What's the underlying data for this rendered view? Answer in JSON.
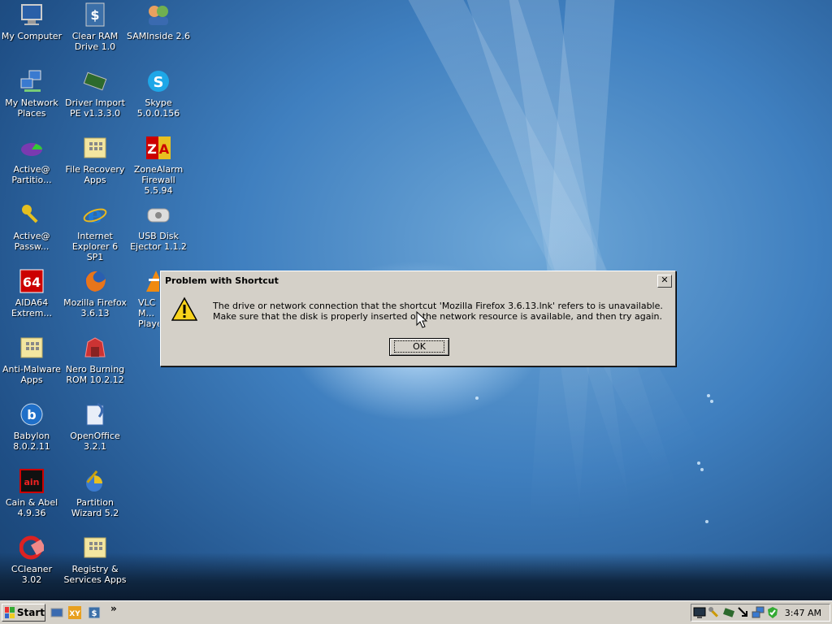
{
  "desktop": {
    "icons": [
      {
        "label": "My Computer",
        "icon": "my-computer-icon"
      },
      {
        "label": "Clear RAM Drive 1.0",
        "icon": "clear-ram-icon"
      },
      {
        "label": "SAMInside 2.6",
        "icon": "saminside-icon"
      },
      {
        "label": "My Network Places",
        "icon": "network-places-icon"
      },
      {
        "label": "Driver Import PE v1.3.3.0",
        "icon": "driver-import-icon"
      },
      {
        "label": "Skype 5.0.0.156",
        "icon": "skype-icon"
      },
      {
        "label": "Active@ Partitio...",
        "icon": "active-partition-icon"
      },
      {
        "label": "File Recovery Apps",
        "icon": "folder-icon"
      },
      {
        "label": "ZoneAlarm Firewall 5.5.94",
        "icon": "zonealarm-icon"
      },
      {
        "label": "Active@ Passw...",
        "icon": "key-icon"
      },
      {
        "label": "Internet Explorer 6 SP1",
        "icon": "internet-explorer-icon"
      },
      {
        "label": "USB Disk Ejector 1.1.2",
        "icon": "usb-disk-icon"
      },
      {
        "label": "AIDA64 Extrem...",
        "icon": "aida64-icon"
      },
      {
        "label": "Mozilla Firefox 3.6.13",
        "icon": "firefox-icon"
      },
      {
        "label": "VLC M... Player",
        "icon": "vlc-icon"
      },
      {
        "label": "Anti-Malware Apps",
        "icon": "folder-icon"
      },
      {
        "label": "Nero Burning ROM 10.2.12",
        "icon": "nero-icon"
      },
      {
        "label": "Babylon 8.0.2.11",
        "icon": "babylon-icon"
      },
      {
        "label": "OpenOffice 3.2.1",
        "icon": "openoffice-icon"
      },
      {
        "label": "Cain & Abel 4.9.36",
        "icon": "cain-abel-icon"
      },
      {
        "label": "Partition Wizard 5.2",
        "icon": "partition-wizard-icon"
      },
      {
        "label": "CCleaner 3.02",
        "icon": "ccleaner-icon"
      },
      {
        "label": "Registry & Services Apps",
        "icon": "folder-icon"
      }
    ]
  },
  "dialog": {
    "title": "Problem with Shortcut",
    "message": "The drive or network connection that the shortcut 'Mozilla Firefox 3.6.13.lnk' refers to is unavailable. Make sure that the disk is properly inserted or the network resource is available, and then try again.",
    "ok_label": "OK",
    "close_glyph": "✕"
  },
  "taskbar": {
    "start_label": "Start",
    "quick_launch_more": "»",
    "clock": "3:47 AM"
  }
}
